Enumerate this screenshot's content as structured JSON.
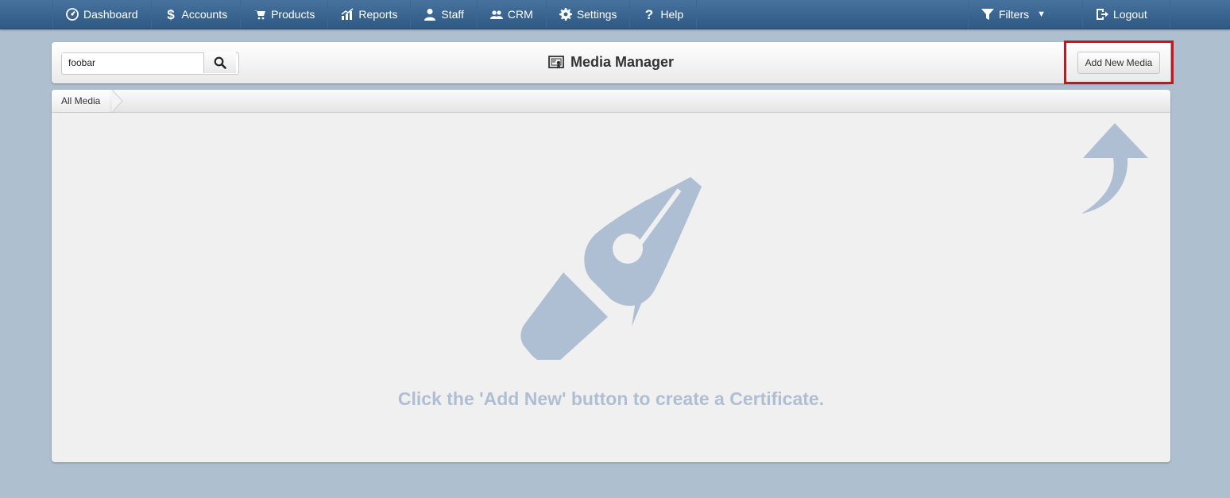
{
  "nav": {
    "left": [
      {
        "label": "Dashboard",
        "icon": "dashboard-icon"
      },
      {
        "label": "Accounts",
        "icon": "dollar-icon"
      },
      {
        "label": "Products",
        "icon": "cart-icon"
      },
      {
        "label": "Reports",
        "icon": "chart-icon"
      },
      {
        "label": "Staff",
        "icon": "user-icon"
      },
      {
        "label": "CRM",
        "icon": "users-icon"
      },
      {
        "label": "Settings",
        "icon": "gear-icon"
      },
      {
        "label": "Help",
        "icon": "question-icon"
      }
    ],
    "right": [
      {
        "label": "Filters",
        "icon": "filter-icon",
        "caret": "▼"
      },
      {
        "label": "Logout",
        "icon": "logout-icon"
      }
    ]
  },
  "header": {
    "search_value": "foobar",
    "title": "Media Manager",
    "title_icon": "certificate-icon",
    "add_button": "Add New Media"
  },
  "breadcrumb": {
    "label": "All Media"
  },
  "empty_state": {
    "message": "Click the 'Add New' button to create a Certificate.",
    "illustration": "pen-nib-icon",
    "pointer": "curved-arrow-up-icon"
  },
  "colors": {
    "nav_bg": "#3a6592",
    "page_bg": "#aebfd0",
    "highlight": "#d0111a",
    "empty_illustration": "#aebfd4"
  }
}
